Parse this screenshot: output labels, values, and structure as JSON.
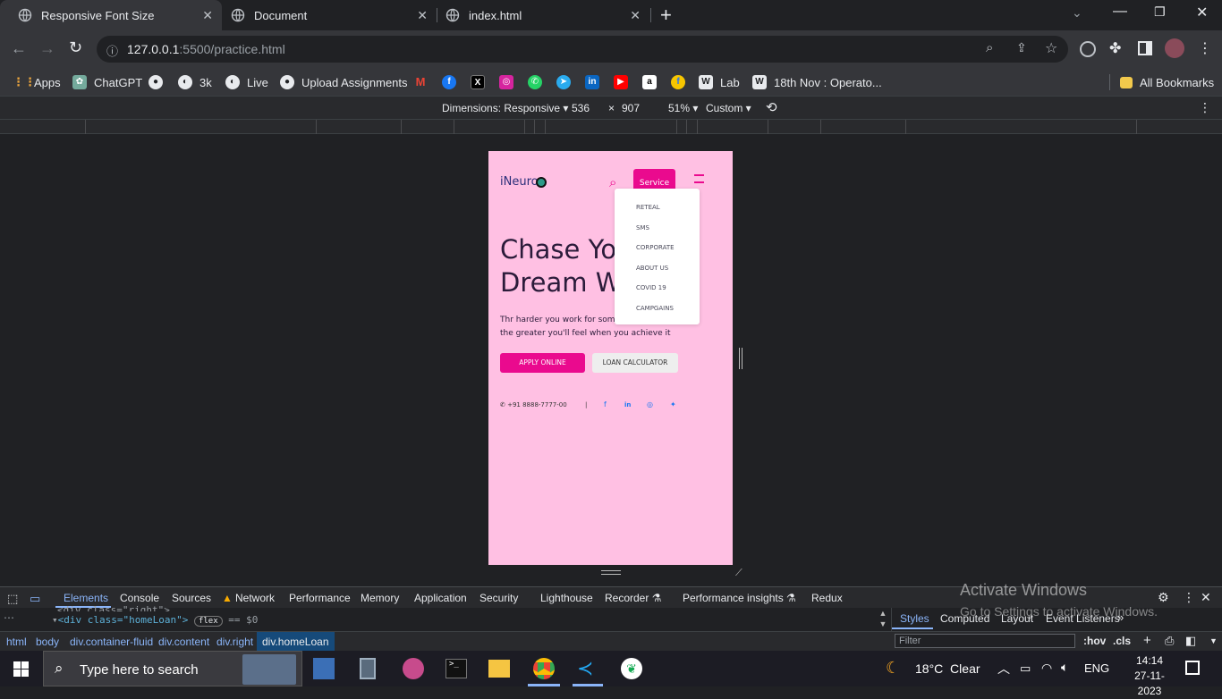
{
  "browser": {
    "tabs": [
      {
        "title": "Responsive Font Size"
      },
      {
        "title": "Document"
      },
      {
        "title": "index.html"
      }
    ],
    "new_tab": "+",
    "url_host": "127.0.0.1",
    "url_rest": ":5500/practice.html",
    "bookmarks": [
      "Apps",
      "ChatGPT",
      "3k",
      "Live",
      "Upload Assignments",
      "Lab",
      "18th Nov : Operato..."
    ],
    "all_bookmarks": "All Bookmarks"
  },
  "device_toolbar": {
    "dimensions_label": "Dimensions: Responsive",
    "width": "536",
    "times": "×",
    "height": "907",
    "zoom": "51%",
    "throttle": "Custom"
  },
  "page": {
    "logo": "iNeuron",
    "service_button": "Service",
    "dropdown": [
      "RETEAL",
      "SMS",
      "CORPORATE",
      "ABOUT US",
      "COVID 19",
      "CAMPGAINS"
    ],
    "heading_line1": "Chase You",
    "heading_line2": "Dream W",
    "para_line1": "Thr harder you work for som",
    "para_line2": "the greater you'll feel when you achieve it",
    "apply_button": "APPLY ONLINE",
    "loan_button": "LOAN CALCULATOR",
    "phone": "+91 8888-7777-00",
    "divider": "|",
    "colors": {
      "background": "#ffc0e3",
      "accent": "#ea0a8e",
      "text": "#2b1b3a"
    }
  },
  "devtools": {
    "tabs": [
      "Elements",
      "Console",
      "Sources",
      "Network",
      "Performance",
      "Memory",
      "Application",
      "Security",
      "Lighthouse",
      "Recorder",
      "Performance insights",
      "Redux"
    ],
    "code_line1": "<div class=\"right\">",
    "code_line2_tag": "<div class=\"homeLoan\">",
    "flex_badge": "flex",
    "code_line2_suffix": "== $0",
    "side_tabs": [
      "Styles",
      "Computed",
      "Layout",
      "Event Listeners"
    ],
    "filter_placeholder": "Filter",
    "hov": ":hov",
    "cls": ".cls",
    "breadcrumbs": [
      "html",
      "body",
      "div.container-fluid",
      "div.content",
      "div.right",
      "div.homeLoan"
    ],
    "watermark_title": "Activate Windows",
    "watermark_sub": "Go to Settings to activate Windows."
  },
  "taskbar": {
    "search_placeholder": "Type here to search",
    "weather": "18°C  Clear",
    "lang": "ENG",
    "time": "14:14",
    "date": "27-11-2023"
  }
}
